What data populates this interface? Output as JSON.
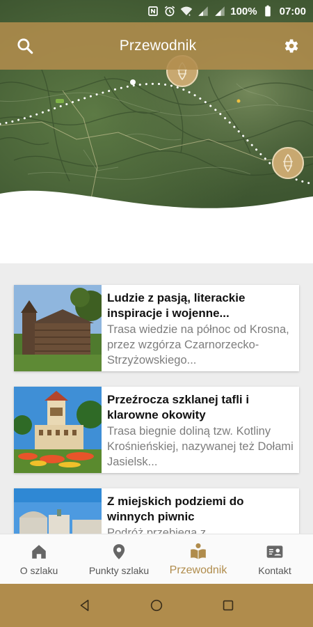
{
  "status_bar": {
    "battery_text": "100%",
    "time": "07:00",
    "icons": [
      "nfc-icon",
      "alarm-icon",
      "wifi-icon",
      "signal-icon",
      "signal-icon",
      "battery-icon"
    ]
  },
  "app_bar": {
    "title": "Przewodnik",
    "search_icon": "search-icon",
    "settings_icon": "gear-icon"
  },
  "colors": {
    "accent": "#b08c4c",
    "title_text": "#111111",
    "desc_text": "#7d7d7d",
    "active_nav": "#b08c4c"
  },
  "guides": [
    {
      "title": "Ludzie z pasją, literackie inspiracje i wojenne...",
      "description": "Trasa wiedzie na północ od Krosna, przez wzgórza Czarnorzecko-Strzyżowskiego...",
      "image": "wooden-church-photo"
    },
    {
      "title": "Przeźrocza szklanej tafli i klarowne okowity",
      "description": "Trasa biegnie doliną tzw. Kotliny Krośnieńskiej, nazywanej też Dołami Jasielsk...",
      "image": "town-hall-tower-photo"
    },
    {
      "title": "Z miejskich podziemi do winnych piwnic",
      "description": "Podróż przebiega z",
      "image": "palace-photo"
    }
  ],
  "bottom_nav": {
    "items": [
      {
        "label": "O szlaku",
        "icon": "home-icon"
      },
      {
        "label": "Punkty szlaku",
        "icon": "map-pin-icon"
      },
      {
        "label": "Przewodnik",
        "icon": "book-reader-icon"
      },
      {
        "label": "Kontakt",
        "icon": "contact-card-icon"
      }
    ],
    "active_index": 2
  },
  "system_nav": {
    "icons": [
      "back-icon",
      "home-circle-icon",
      "recents-icon"
    ]
  }
}
